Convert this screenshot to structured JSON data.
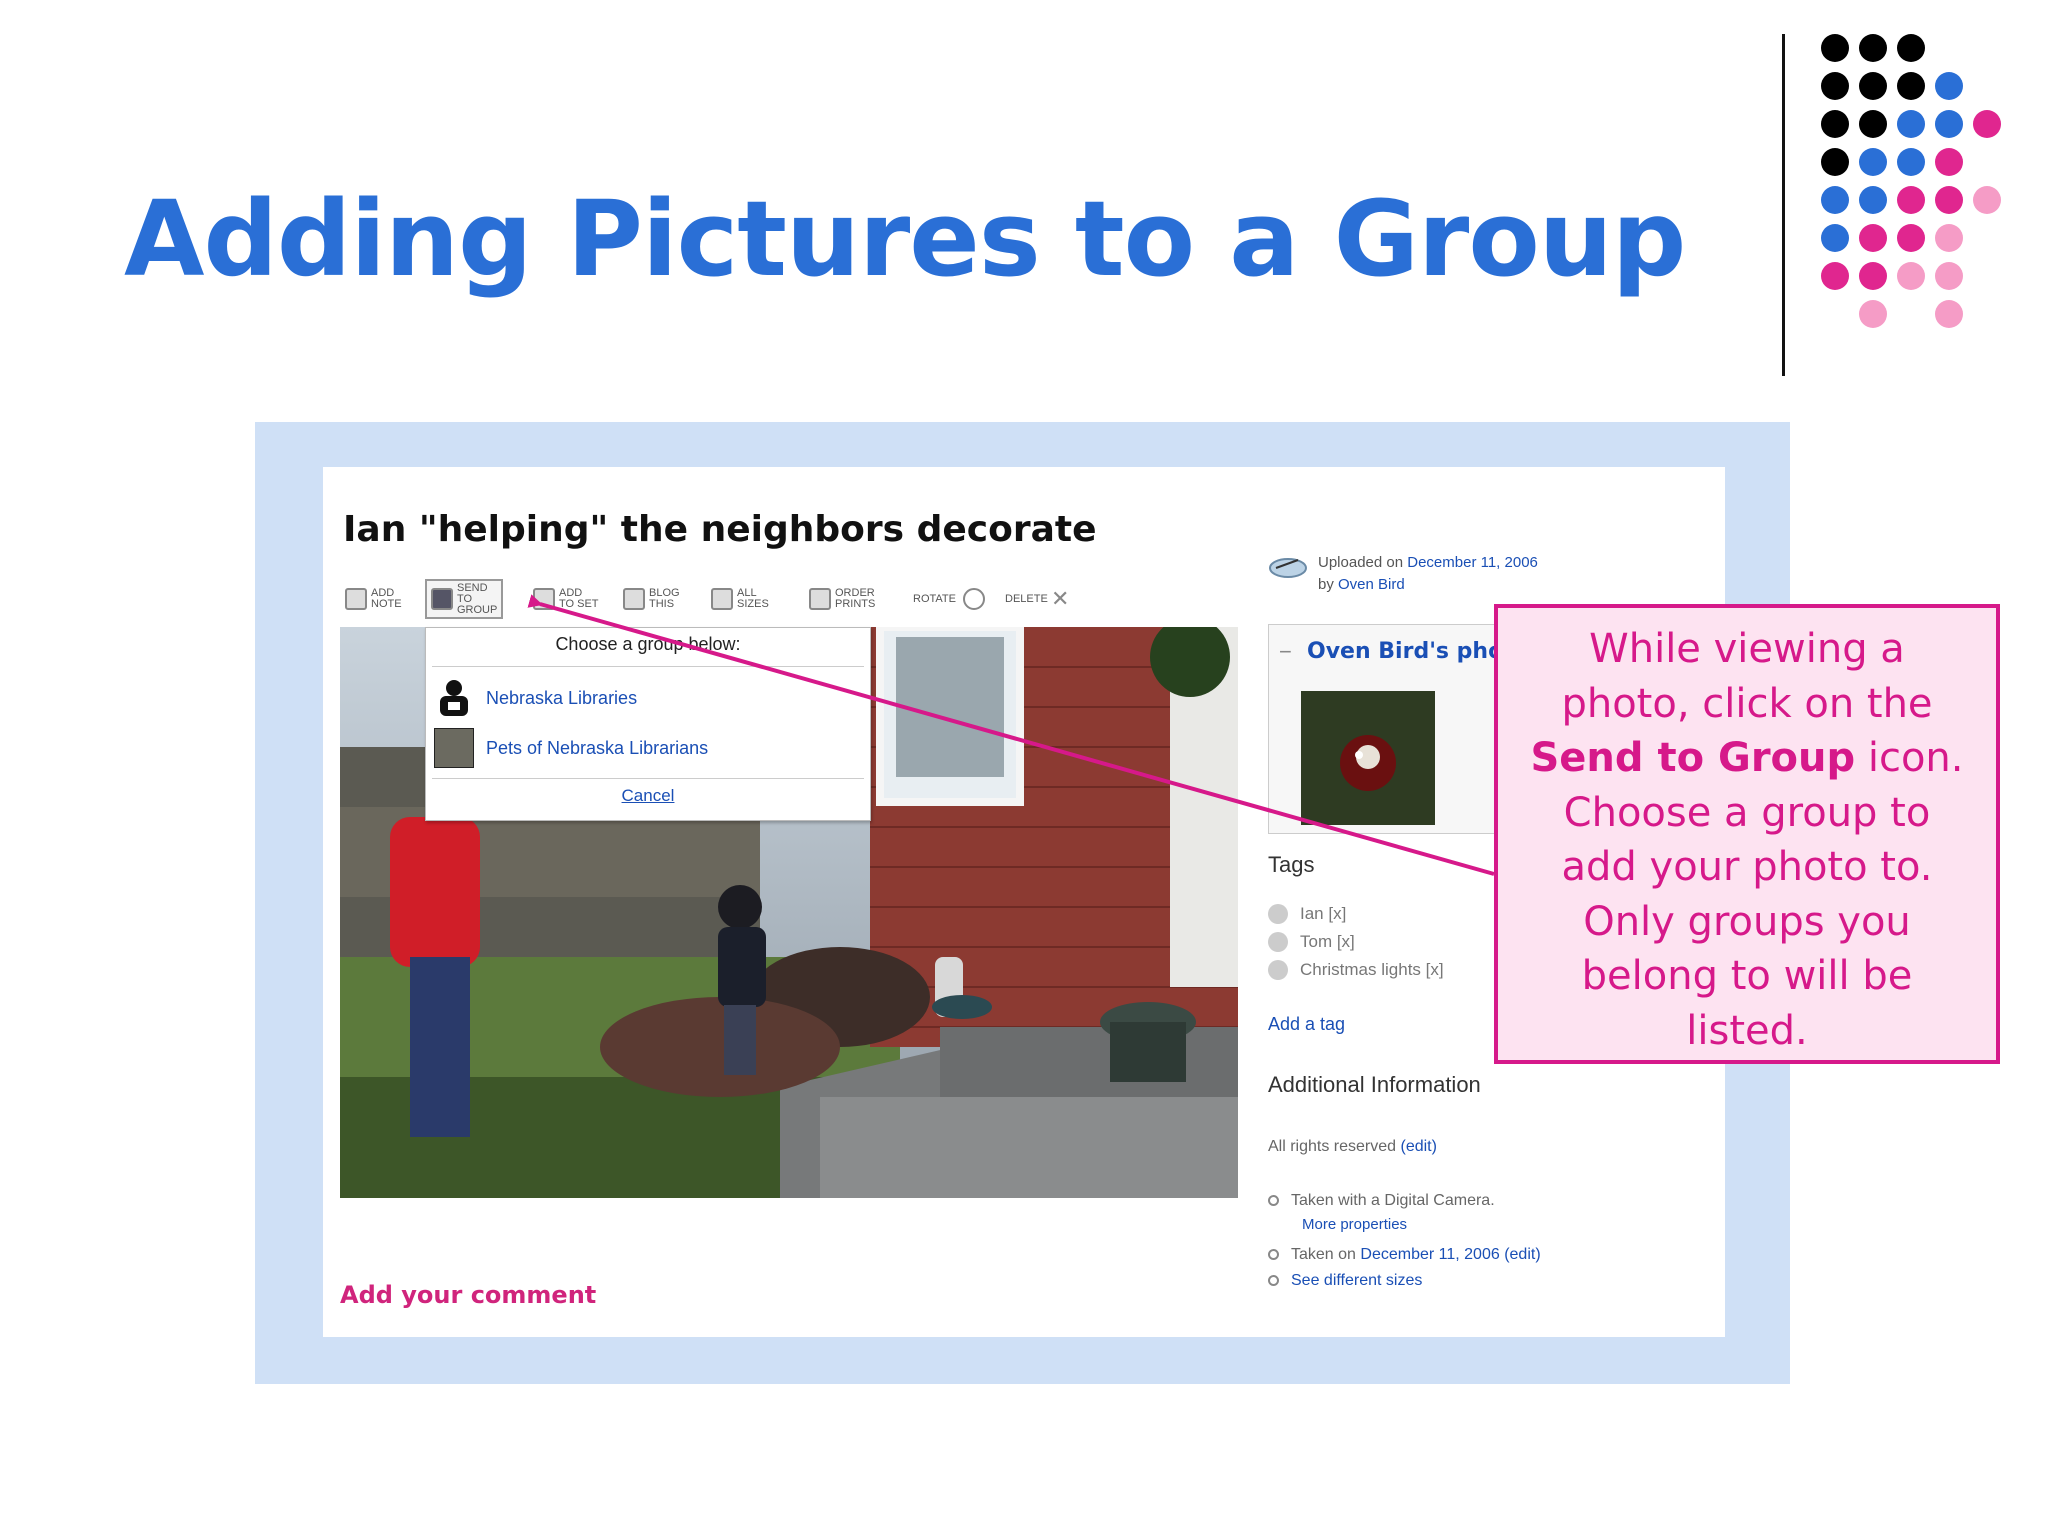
{
  "slide": {
    "title": "Adding Pictures to a Group",
    "brand_color": "#2a6fd6",
    "accent_color": "#d6198a"
  },
  "photo_page": {
    "title": "Ian \"helping\" the neighbors decorate",
    "toolbar": {
      "items": [
        {
          "icon": "add-note-icon",
          "label": "ADD NOTE"
        },
        {
          "icon": "send-to-group-icon",
          "label": "SEND TO GROUP"
        },
        {
          "icon": "add-to-set-icon",
          "label": "ADD TO SET"
        },
        {
          "icon": "blog-this-icon",
          "label": "BLOG THIS"
        },
        {
          "icon": "all-sizes-icon",
          "label": "ALL SIZES"
        },
        {
          "icon": "order-prints-icon",
          "label": "ORDER PRINTS"
        },
        {
          "icon": "rotate-icon",
          "label": "ROTATE"
        },
        {
          "icon": "delete-icon",
          "label": "DELETE"
        }
      ]
    },
    "group_popup": {
      "heading": "Choose a group below:",
      "groups": [
        {
          "name": "Nebraska Libraries",
          "icon": "group-avatar-icon"
        },
        {
          "name": "Pets of Nebraska Librarians",
          "icon": "group-avatar-icon"
        }
      ],
      "cancel": "Cancel"
    },
    "add_comment": "Add your comment",
    "sidebar": {
      "uploaded_prefix": "Uploaded on",
      "uploaded_date": "December 11, 2006",
      "by_prefix": "by",
      "owner": "Oven Bird",
      "photostream_title": "Oven Bird's photostream",
      "tags_heading": "Tags",
      "tags": [
        "Ian [x]",
        "Tom [x]",
        "Christmas lights [x]"
      ],
      "add_tag": "Add a tag",
      "additional_heading": "Additional Information",
      "rights": "All rights reserved",
      "rights_edit": "(edit)",
      "taken_with": "Taken with a Digital Camera.",
      "more_properties": "More properties",
      "taken_on_prefix": "Taken on",
      "taken_on_date": "December 11, 2006",
      "taken_on_edit": "(edit)",
      "see_sizes": "See different sizes"
    }
  },
  "callout": {
    "line1": "While viewing a",
    "line2": "photo, click on the",
    "line3_bold": "Send to Group",
    "line3_rest": " icon.",
    "line4": "Choose a group to",
    "line5": "add your photo to.",
    "line6": "Only groups you",
    "line7": "belong to will be",
    "line8": "listed."
  }
}
